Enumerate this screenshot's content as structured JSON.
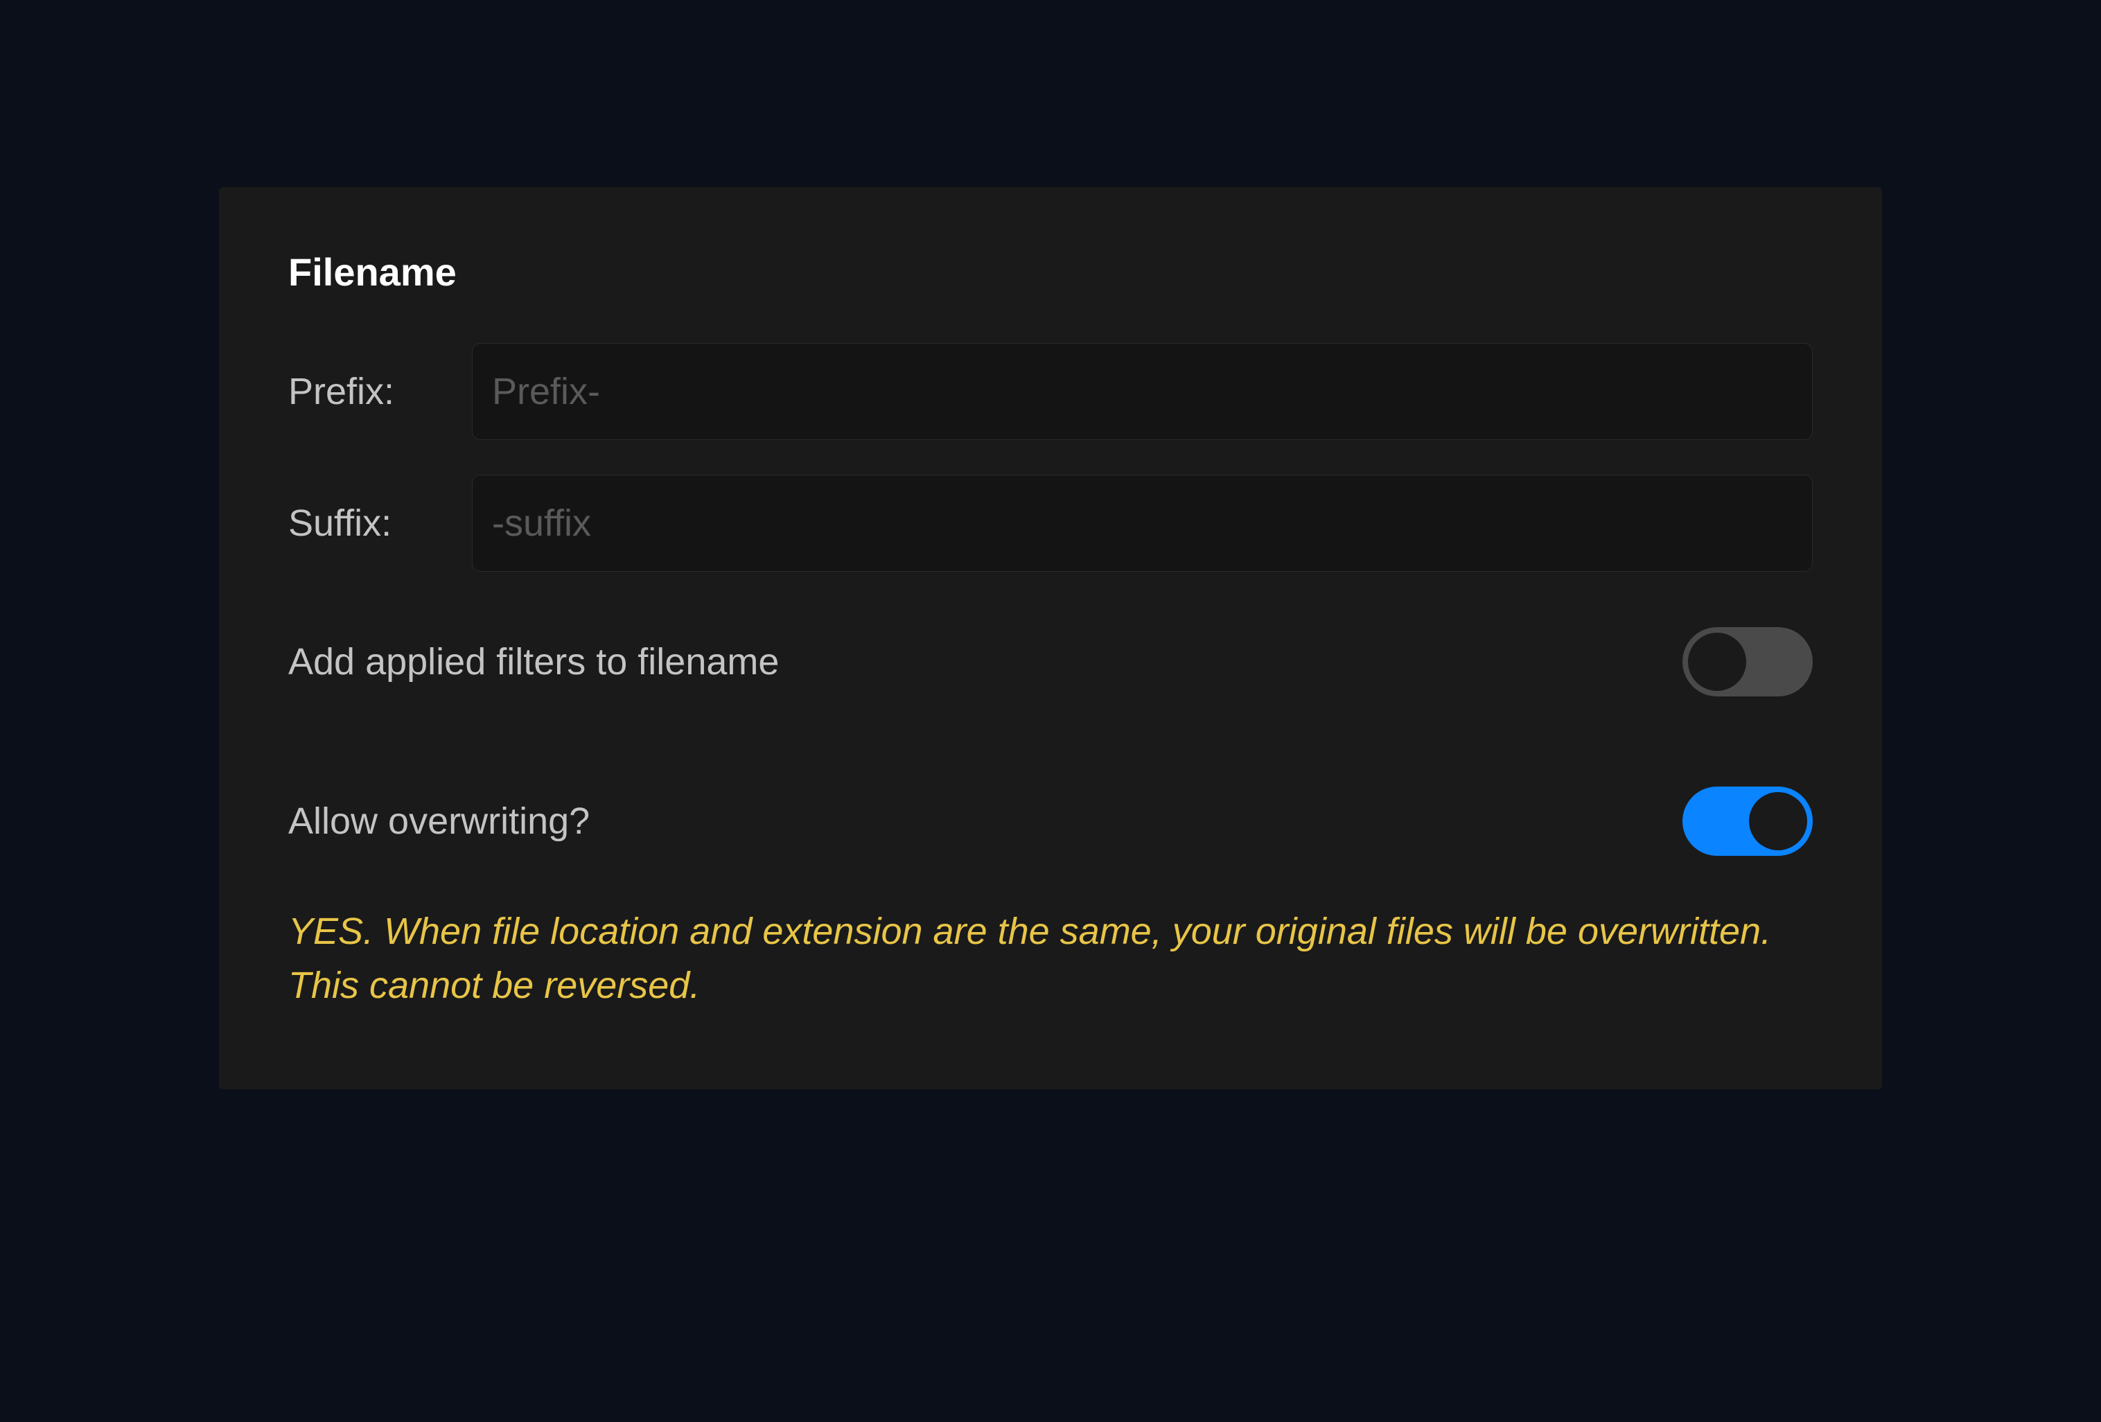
{
  "panel": {
    "title": "Filename",
    "prefix": {
      "label": "Prefix:",
      "placeholder": "Prefix-",
      "value": ""
    },
    "suffix": {
      "label": "Suffix:",
      "placeholder": "-suffix",
      "value": ""
    },
    "addFilters": {
      "label": "Add applied filters to filename",
      "enabled": false
    },
    "allowOverwrite": {
      "label": "Allow overwriting?",
      "enabled": true
    },
    "warning": "YES. When file location and extension are the same, your original files will be overwritten. This cannot be reversed."
  }
}
